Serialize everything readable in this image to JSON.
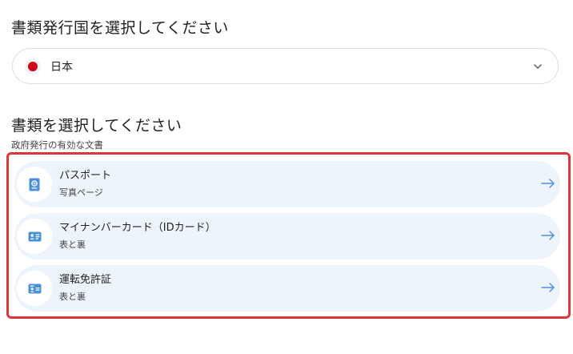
{
  "country_section": {
    "heading": "書類発行国を選択してください",
    "selected_country": "日本",
    "flag_color": "#d0021b"
  },
  "document_section": {
    "heading": "書類を選択してください",
    "subheading": "政府発行の有効な文書",
    "highlight_color": "#e0353a",
    "items": [
      {
        "title": "パスポート",
        "subtitle": "写真ページ",
        "icon": "passport-icon"
      },
      {
        "title": "マイナンバーカード（IDカード）",
        "subtitle": "表と裏",
        "icon": "id-card-icon"
      },
      {
        "title": "運転免許証",
        "subtitle": "表と裏",
        "icon": "drivers-license-icon"
      }
    ]
  },
  "colors": {
    "accent": "#4a90d9",
    "item_background": "#eef4fb"
  }
}
